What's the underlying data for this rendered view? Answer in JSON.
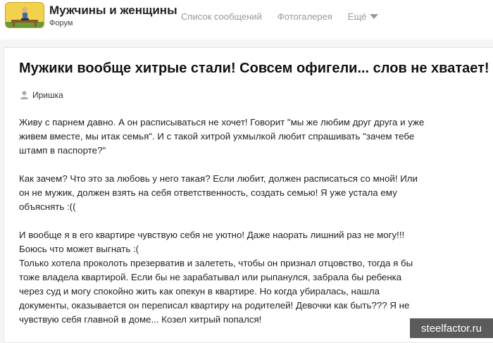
{
  "header": {
    "site_title": "Мужчины и женщины",
    "site_subtitle": "Форум",
    "logo_icon": "forum-logo-icon",
    "nav": [
      {
        "label": "Список сообщений"
      },
      {
        "label": "Фотогалерея"
      },
      {
        "label": "Ещё"
      }
    ],
    "more_icon": "caret-down-icon"
  },
  "post": {
    "title": "Мужики вообще хитрые стали! Совсем офигели... слов не хватает!",
    "author": "Иришка",
    "author_icon": "user-icon",
    "paragraphs": [
      "Живу с парнем давно. А он расписываться не хочет! Говорит \"мы же любим друг друга и уже\nживем вместе, мы итак семья\". И с такой хитрой ухмылкой любит спрашивать \"зачем тебе\nштамп в паспорте?\"",
      "Как зачем? Что это за любовь у него такая? Если любит, должен расписаться со мной! Или\nон не мужик, должен взять на себя ответственность, создать семью! Я уже устала ему\nобъяснять :((",
      "И вообще я в его квартире чувствую себя не уютно! Даже наорать лишний раз не могу!!!\nБоюсь что может выгнать :(\nТолько хотела проколоть презерватив и залететь, чтобы он признал отцовство, тогда я бы\nтоже владела квартирой. Если бы не зарабатывал или рыпанулся, забрала бы ребенка\nчерез суд и могу спокойно жить как опекун в квартире. Но когда убиралась, нашла\nдокументы, оказывается он переписал квартиру на родителей! Девочки как быть??? Я не\nчувствую себя главной в доме... Козел хитрый попался!"
    ]
  },
  "watermark": "steelfactor.ru",
  "colors": {
    "background": "#f5f5f5",
    "logo": "#f2d24b",
    "nav_text": "#999999",
    "watermark_bg": "#5b5b5b"
  }
}
